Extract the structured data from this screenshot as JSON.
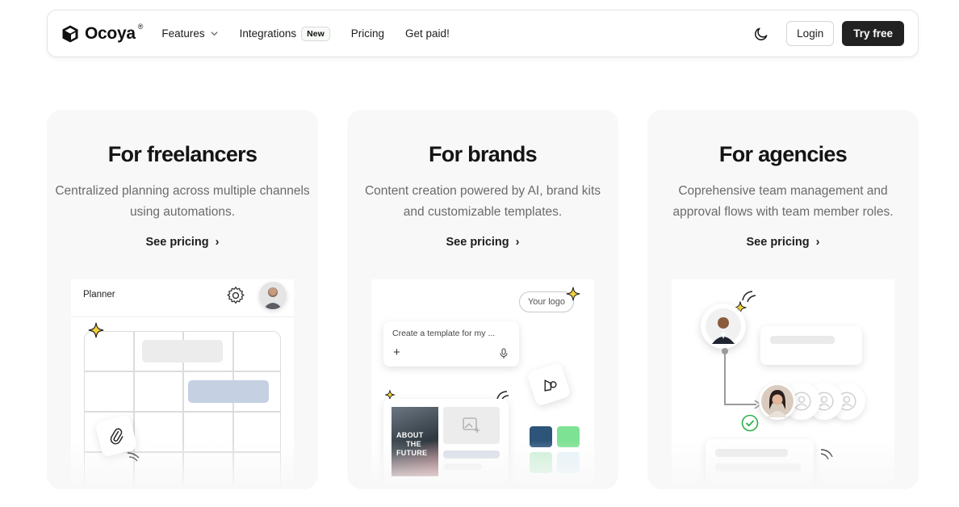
{
  "nav": {
    "brand": "Ocoya",
    "brand_mark": "®",
    "links": [
      {
        "label": "Features",
        "has_dropdown": true
      },
      {
        "label": "Integrations",
        "badge": "New"
      },
      {
        "label": "Pricing"
      },
      {
        "label": "Get paid!"
      }
    ],
    "theme_toggle_icon": "moon-icon",
    "login_label": "Login",
    "try_label": "Try free"
  },
  "cards": [
    {
      "title": "For freelancers",
      "description": "Centralized planning across multiple channels using automations.",
      "link_label": "See pricing",
      "preview": {
        "header_label": "Planner"
      }
    },
    {
      "title": "For brands",
      "description": "Content creation powered by AI, brand kits and customizable templates.",
      "link_label": "See pricing",
      "preview": {
        "logo_chip": "Your logo",
        "prompt_text": "Create a template for my ...",
        "poster_text": [
          "ABOUT",
          "THE",
          "FUTURE"
        ],
        "swatches": [
          "#2d557a",
          "#7ee294",
          "#c9efd5",
          "#e4f2f9"
        ]
      }
    },
    {
      "title": "For agencies",
      "description": "Coprehensive team management and approval flows with team member roles.",
      "link_label": "See pricing",
      "preview": {}
    }
  ],
  "colors": {
    "accent_dark": "#222222",
    "card_bg": "#f8f8f8",
    "approve_green": "#2fb04a"
  }
}
